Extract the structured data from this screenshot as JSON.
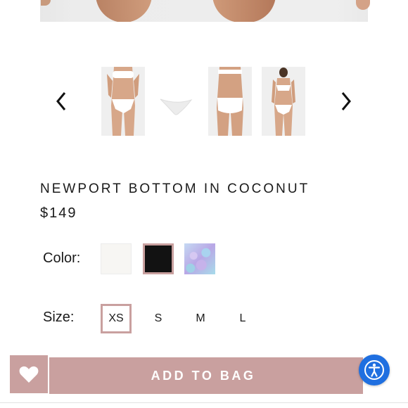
{
  "product": {
    "title": "NEWPORT BOTTOM IN COCONUT",
    "price": "$149"
  },
  "carousel": {
    "prev_icon": "chevron-left-icon",
    "next_icon": "chevron-right-icon",
    "thumbnails": [
      "front-view",
      "flat-lay",
      "back-view",
      "full-body-view"
    ]
  },
  "color": {
    "label": "Color:",
    "options": [
      {
        "name": "coconut",
        "hex": "#f7f6f3"
      },
      {
        "name": "black",
        "hex": "#111111",
        "selected": true
      },
      {
        "name": "print",
        "hex": "#b9a7e6"
      }
    ]
  },
  "size": {
    "label": "Size:",
    "options": [
      "XS",
      "S",
      "M",
      "L"
    ],
    "selected": "XS"
  },
  "actions": {
    "add_to_bag": "ADD TO BAG",
    "wishlist_icon": "heart-icon",
    "accessibility_icon": "accessibility-icon"
  },
  "colors": {
    "accent": "#c9a09f",
    "accessibility_blue": "#1f6fe0"
  }
}
